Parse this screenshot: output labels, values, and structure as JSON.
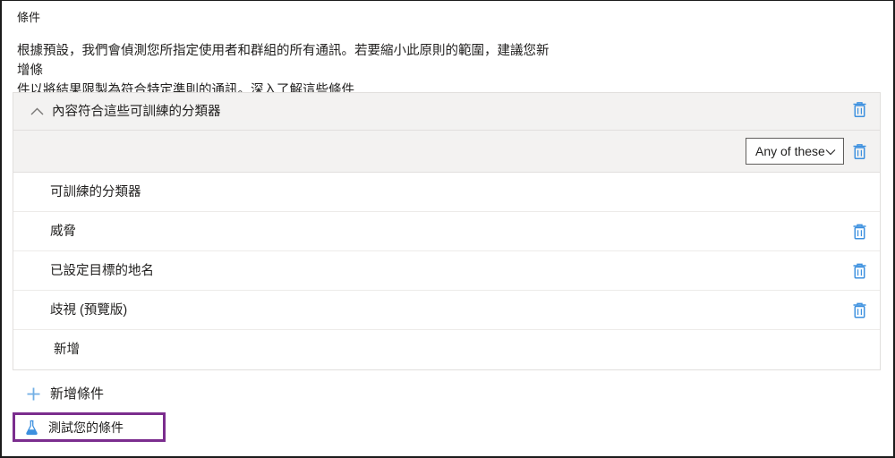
{
  "page": {
    "title": "條件",
    "description_line1": "根據預設，我們會偵測您所指定使用者和群組的所有通訊。若要縮小此原則的範圍，建議您新增條",
    "description_line2": "件以將結果限製為符合特定準則的通訊。",
    "description_link": "深入了解這些條件"
  },
  "condition_group": {
    "header_title": "內容符合這些可訓練的分類器",
    "collapse_icon": "chevron-up-icon",
    "header_delete_icon": "trash-icon",
    "match_dropdown": {
      "value": "Any of these",
      "chevron_icon": "chevron-down-icon"
    },
    "subbar_delete_icon": "trash-icon",
    "rows": [
      {
        "label": "可訓練的分類器",
        "has_delete": false
      },
      {
        "label": "威脅",
        "has_delete": true
      },
      {
        "label": "已設定目標的地名",
        "has_delete": true
      },
      {
        "label": "歧視 (預覽版)",
        "has_delete": true
      }
    ],
    "add_row_label": "新增"
  },
  "actions": {
    "add_condition_label": "新增條件",
    "add_condition_icon": "plus-icon",
    "test_button_label": "測試您的條件",
    "test_button_icon": "flask-icon"
  },
  "colors": {
    "accent_blue": "#0078d4",
    "trash_blue": "#3c90df",
    "plus_blue": "#71afe5",
    "highlight_purple": "#7b2d8e",
    "panel_gray": "#f3f2f1",
    "border_gray": "#e1dfdd"
  }
}
